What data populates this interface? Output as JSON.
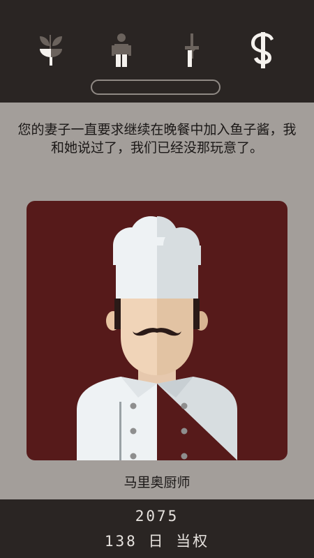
{
  "stats": [
    {
      "icon": "church-icon",
      "level": 0.5
    },
    {
      "icon": "people-icon",
      "level": 0.4
    },
    {
      "icon": "army-icon",
      "level": 0.5
    },
    {
      "icon": "money-icon",
      "level": 1.0
    }
  ],
  "colors": {
    "top_bar": "#2a2523",
    "background": "#a39e9a",
    "card_background": "#561a1a",
    "icon_light": "#f5f2ee",
    "icon_dark": "#6b635d"
  },
  "message": "您的妻子一直要求继续在晚餐中加入鱼子酱，我和她说过了，我们已经没那玩意了。",
  "character": {
    "name": "马里奥厨师",
    "portrait": "chef-portrait"
  },
  "status": {
    "year": "2075",
    "reign": "138 日 当权"
  }
}
